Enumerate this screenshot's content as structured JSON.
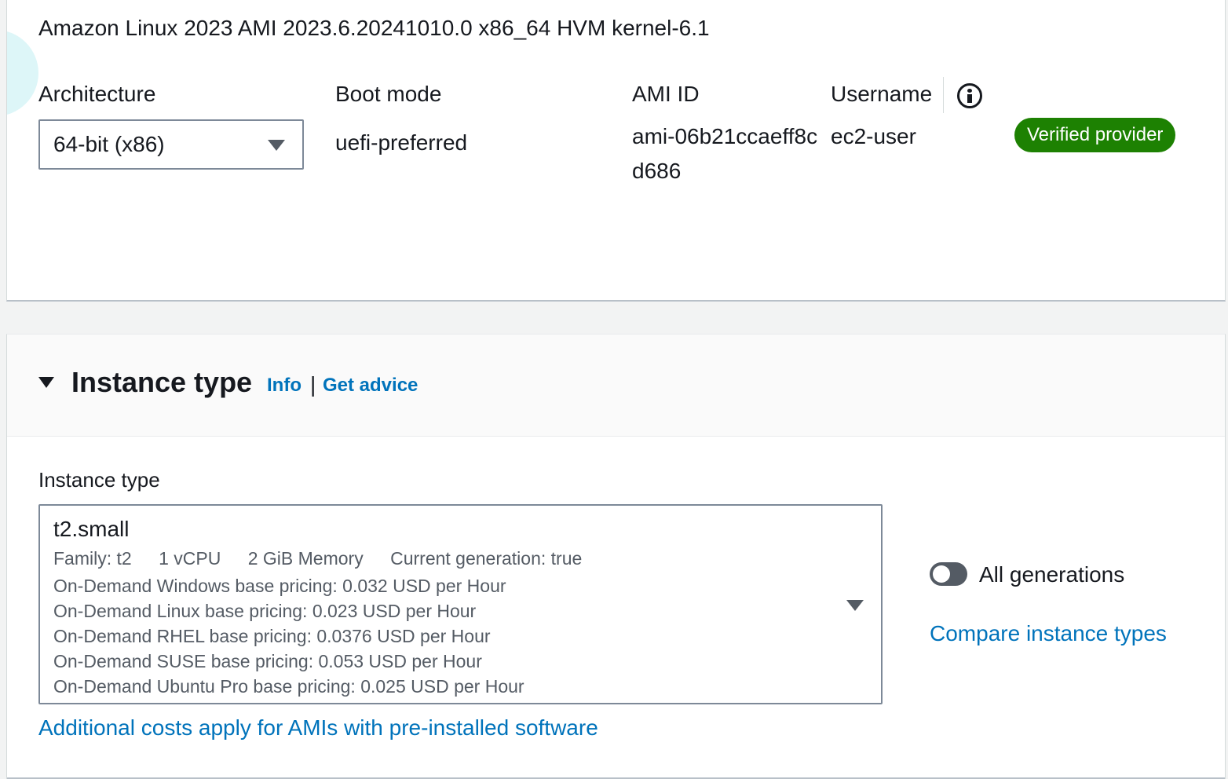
{
  "ami": {
    "title": "Amazon Linux 2023 AMI 2023.6.20241010.0 x86_64 HVM kernel-6.1",
    "architecture_label": "Architecture",
    "architecture_value": "64-bit (x86)",
    "boot_mode_label": "Boot mode",
    "boot_mode_value": "uefi-preferred",
    "ami_id_label": "AMI ID",
    "ami_id_value": "ami-06b21ccaeff8cd686",
    "username_label": "Username",
    "username_value": "ec2-user",
    "verified_badge": "Verified provider"
  },
  "instance_type_section": {
    "title": "Instance type",
    "info_link": "Info",
    "separator": "|",
    "advice_link": "Get advice",
    "field_label": "Instance type",
    "selected": {
      "name": "t2.small",
      "family": "Family: t2",
      "vcpu": "1 vCPU",
      "memory": "2 GiB Memory",
      "generation": "Current generation: true",
      "pricing": [
        "On-Demand Windows base pricing: 0.032 USD per Hour",
        "On-Demand Linux base pricing: 0.023 USD per Hour",
        "On-Demand RHEL base pricing: 0.0376 USD per Hour",
        "On-Demand SUSE base pricing: 0.053 USD per Hour",
        "On-Demand Ubuntu Pro base pricing: 0.025 USD per Hour"
      ]
    },
    "all_generations_label": "All generations",
    "all_generations_enabled": false,
    "compare_link": "Compare instance types",
    "additional_costs_link": "Additional costs apply for AMIs with pre-installed software"
  },
  "icons": {
    "architecture_dropdown": "caret-down-icon",
    "instance_dropdown": "caret-down-icon",
    "username_info": "info-icon",
    "section_collapse": "caret-down-icon"
  },
  "colors": {
    "link": "#0073bb",
    "verified_badge": "#1d8102",
    "toggle_off": "#545b64"
  }
}
